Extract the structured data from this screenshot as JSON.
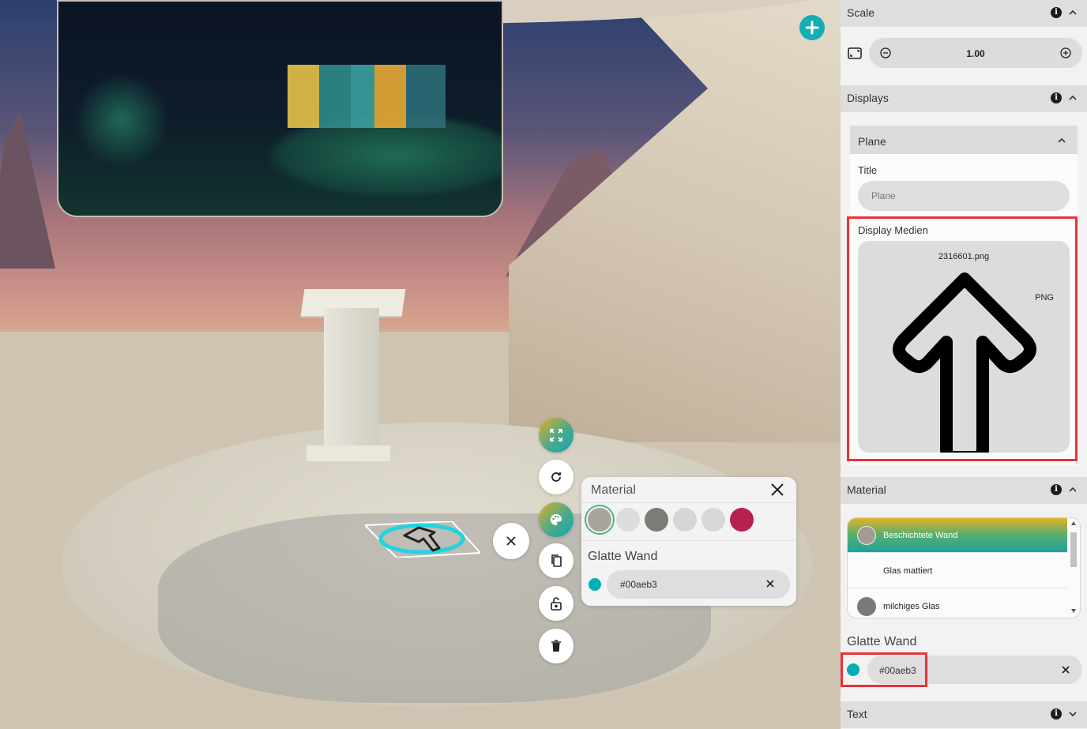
{
  "panel": {
    "scale": {
      "title": "Scale",
      "value": "1.00"
    },
    "displays": {
      "title": "Displays",
      "plane": {
        "title": "Plane",
        "title_field_label": "Title",
        "title_placeholder": "Plane",
        "media_label": "Display Medien",
        "media_filename": "2316601.png",
        "media_type": "PNG"
      }
    },
    "material": {
      "title": "Material",
      "items": [
        {
          "label": "Beschichtete Wand",
          "active": true,
          "thumb_color": "#a29c94"
        },
        {
          "label": "Glas mattiert",
          "active": false,
          "thumb_color": null
        },
        {
          "label": "milchiges Glas",
          "active": false,
          "thumb_color": "#7b7a77"
        }
      ],
      "selected_name": "Glatte Wand",
      "color_value": "#00aeb3"
    },
    "text_section": {
      "title": "Text"
    }
  },
  "popup": {
    "title": "Material",
    "subtitle": "Glatte Wand",
    "color_value": "#00aeb3",
    "swatches": [
      "#a8a39b",
      "#dcdcdc",
      "#7d7b78",
      "#d6d6d6",
      "#d8d8d8",
      "#b8204f"
    ]
  },
  "colors": {
    "accent": "#00aeb3",
    "highlight": "#e8333a"
  },
  "icons": {
    "add": "plus-circle-icon",
    "info": "info-icon",
    "expand": "expand-icon",
    "rotate": "rotate-icon",
    "palette": "palette-icon",
    "copy": "copy-icon",
    "lock": "lock-icon",
    "delete": "trash-icon",
    "close": "close-icon"
  }
}
